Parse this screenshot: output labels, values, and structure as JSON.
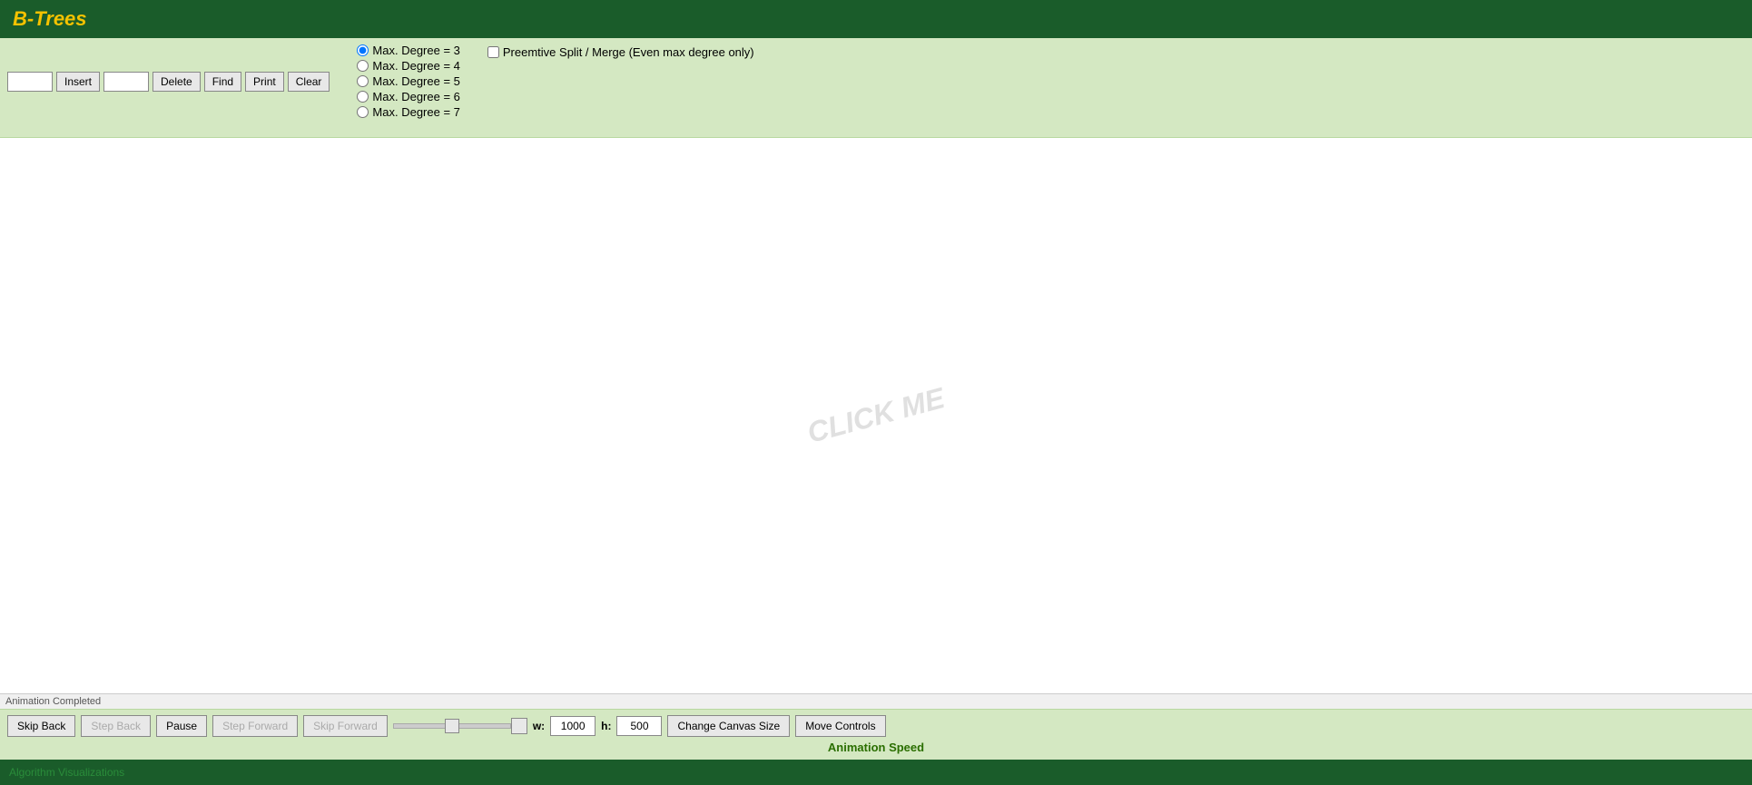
{
  "app": {
    "title": "B-Trees"
  },
  "toolbar": {
    "insert_value": "",
    "insert_placeholder": "",
    "delete_value": "",
    "delete_placeholder": "",
    "find_label": "Find",
    "insert_label": "Insert",
    "delete_label": "Delete",
    "print_label": "Print",
    "clear_label": "Clear"
  },
  "degrees": [
    {
      "label": "Max. Degree = 3",
      "value": "3",
      "checked": true
    },
    {
      "label": "Max. Degree = 4",
      "value": "4",
      "checked": false
    },
    {
      "label": "Max. Degree = 5",
      "value": "5",
      "checked": false
    },
    {
      "label": "Max. Degree = 6",
      "value": "6",
      "checked": false
    },
    {
      "label": "Max. Degree = 7",
      "value": "7",
      "checked": false
    }
  ],
  "preemtive": {
    "label": "Preemtive Split / Merge (Even max degree only)",
    "checked": false
  },
  "watermark": "CLICK ME",
  "status": {
    "text": "Animation Completed"
  },
  "bottom": {
    "skip_back_label": "Skip Back",
    "step_back_label": "Step Back",
    "pause_label": "Pause",
    "step_forward_label": "Step Forward",
    "skip_forward_label": "Skip Forward",
    "w_label": "w:",
    "w_value": "1000",
    "h_label": "h:",
    "h_value": "500",
    "change_canvas_label": "Change Canvas Size",
    "move_controls_label": "Move Controls",
    "animation_speed_label": "Animation Speed"
  },
  "footer": {
    "text": "Algorithm Visualizations"
  }
}
